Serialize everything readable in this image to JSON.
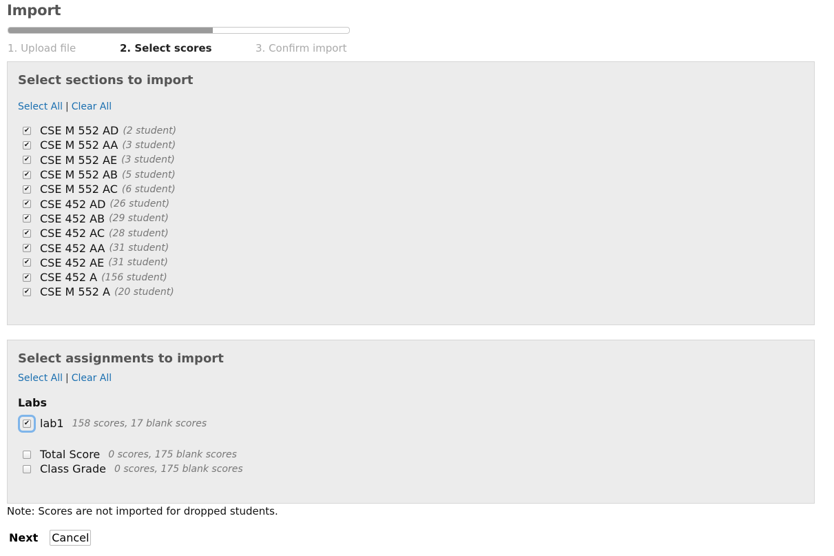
{
  "page": {
    "title": "Import"
  },
  "progress": {
    "fraction": 0.6
  },
  "steps": [
    "1. Upload file",
    "2. Select scores",
    "3. Confirm import"
  ],
  "sections_panel": {
    "title": "Select sections to import",
    "select_all": "Select All",
    "separator": "|",
    "clear_all": "Clear All",
    "items": [
      {
        "name": "CSE M 552 AD",
        "count": "(2 student)",
        "checked": true
      },
      {
        "name": "CSE M 552 AA",
        "count": "(3 student)",
        "checked": true
      },
      {
        "name": "CSE M 552 AE",
        "count": "(3 student)",
        "checked": true
      },
      {
        "name": "CSE M 552 AB",
        "count": "(5 student)",
        "checked": true
      },
      {
        "name": "CSE M 552 AC",
        "count": "(6 student)",
        "checked": true
      },
      {
        "name": "CSE 452 AD",
        "count": "(26 student)",
        "checked": true
      },
      {
        "name": "CSE 452 AB",
        "count": "(29 student)",
        "checked": true
      },
      {
        "name": "CSE 452 AC",
        "count": "(28 student)",
        "checked": true
      },
      {
        "name": "CSE 452 AA",
        "count": "(31 student)",
        "checked": true
      },
      {
        "name": "CSE 452 AE",
        "count": "(31 student)",
        "checked": true
      },
      {
        "name": "CSE 452 A",
        "count": "(156 student)",
        "checked": true
      },
      {
        "name": "CSE M 552 A",
        "count": "(20 student)",
        "checked": true
      }
    ]
  },
  "assignments_panel": {
    "title": "Select assignments to import",
    "select_all": "Select All",
    "separator": "|",
    "clear_all": "Clear All",
    "group_title": "Labs",
    "lab": {
      "name": "lab1",
      "count": "158 scores, 17 blank scores",
      "checked": true
    },
    "others": [
      {
        "name": "Total Score",
        "count": "0 scores, 175 blank scores",
        "checked": false
      },
      {
        "name": "Class Grade",
        "count": "0 scores, 175 blank scores",
        "checked": false
      }
    ]
  },
  "note": "Note: Scores are not imported for dropped students.",
  "actions": {
    "next": "Next",
    "cancel": "Cancel"
  },
  "check_glyph": "✔",
  "colors": {
    "link": "#1a6fb0",
    "panel_bg": "#ececec",
    "focus_ring": "#7fb5ea",
    "progress_fill": "#9a9a9a"
  }
}
